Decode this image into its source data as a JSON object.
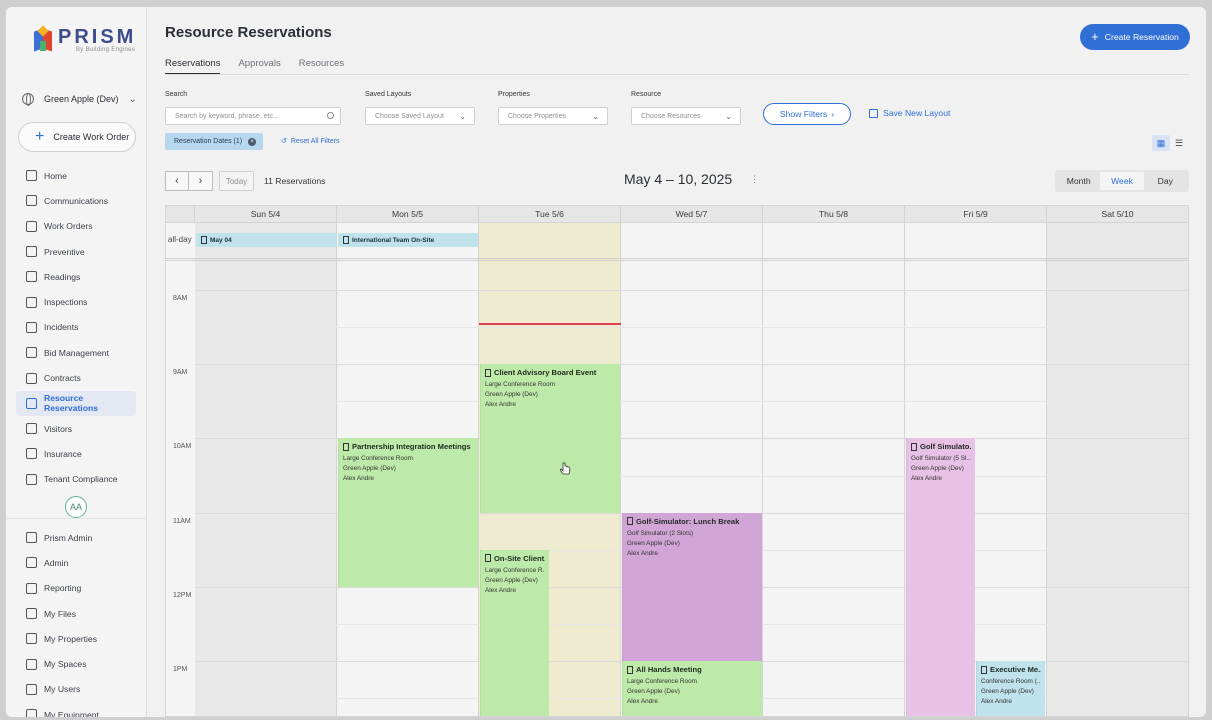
{
  "brand": {
    "name": "PRISM",
    "sub": "By Building Engines"
  },
  "sidebar": {
    "property": "Green Apple (Dev)",
    "create_work_order": "Create Work Order",
    "items": [
      {
        "label": "Home",
        "icon": "home-icon",
        "active": false
      },
      {
        "label": "Communications",
        "icon": "megaphone-icon",
        "active": false
      },
      {
        "label": "Work Orders",
        "icon": "wrench-icon",
        "active": false
      },
      {
        "label": "Preventive",
        "icon": "calendar-check-icon",
        "active": false
      },
      {
        "label": "Readings",
        "icon": "gauge-icon",
        "active": false
      },
      {
        "label": "Inspections",
        "icon": "clipboard-icon",
        "active": false
      },
      {
        "label": "Incidents",
        "icon": "alert-icon",
        "active": false
      },
      {
        "label": "Bid Management",
        "icon": "gavel-icon",
        "active": false
      },
      {
        "label": "Contracts",
        "icon": "contract-icon",
        "active": false
      },
      {
        "label": "Resource Reservations",
        "icon": "calendar-icon",
        "active": true
      },
      {
        "label": "Visitors",
        "icon": "visitor-icon",
        "active": false
      },
      {
        "label": "Insurance",
        "icon": "shield-icon",
        "active": false
      },
      {
        "label": "Tenant Compliance",
        "icon": "check-circle-icon",
        "active": false
      }
    ],
    "avatar": "AA",
    "bottom_items": [
      {
        "label": "Prism Admin",
        "icon": "gear-icon"
      },
      {
        "label": "Admin",
        "icon": "gear-icon"
      },
      {
        "label": "Reporting",
        "icon": "chart-icon"
      },
      {
        "label": "My Files",
        "icon": "file-icon"
      },
      {
        "label": "My Properties",
        "icon": "building-icon"
      },
      {
        "label": "My Spaces",
        "icon": "layers-icon"
      },
      {
        "label": "My Users",
        "icon": "users-icon"
      },
      {
        "label": "My Equipment",
        "icon": "equipment-icon"
      }
    ]
  },
  "header": {
    "title": "Resource Reservations",
    "create_button": "Create Reservation",
    "tabs": [
      "Reservations",
      "Approvals",
      "Resources"
    ],
    "active_tab": "Reservations"
  },
  "filters": {
    "search_label": "Search",
    "search_placeholder": "Search by keyword, phrase, etc...",
    "saved_layouts_label": "Saved Layouts",
    "saved_layouts_value": "Choose Saved Layout",
    "properties_label": "Properties",
    "properties_value": "Choose Properties",
    "resource_label": "Resource",
    "resource_value": "Choose Resources",
    "show_filters": "Show Filters",
    "save_layout": "Save New Layout",
    "chip": "Reservation Dates (1)",
    "reset": "Reset All Filters"
  },
  "toolbar": {
    "today": "Today",
    "count": "11 Reservations",
    "range": "May 4 – 10, 2025",
    "views": [
      "Month",
      "Week",
      "Day"
    ],
    "active_view": "Week"
  },
  "calendar": {
    "days": [
      "Sun 5/4",
      "Mon 5/5",
      "Tue 5/6",
      "Wed 5/7",
      "Thu 5/8",
      "Fri 5/9",
      "Sat 5/10"
    ],
    "allday_label": "all-day",
    "times": [
      "8AM",
      "9AM",
      "10AM",
      "11AM",
      "12PM",
      "1PM"
    ],
    "allday_events": [
      {
        "title": "May 04",
        "day": 0
      },
      {
        "title": "International Team On-Site",
        "day": 1
      }
    ],
    "events": [
      {
        "title": "Client Advisory Board Event",
        "room": "Large Conference Room",
        "property": "Green Apple (Dev)",
        "person": "Alex Andre",
        "day": 2,
        "start": 9.0,
        "end": 11.0,
        "color": "#bdeaa9"
      },
      {
        "title": "Partnership Integration Meetings",
        "room": "Large Conference Room",
        "property": "Green Apple (Dev)",
        "person": "Alex Andre",
        "day": 1,
        "start": 10.0,
        "end": 12.0,
        "color": "#bdeaa9"
      },
      {
        "title": "Golf Simulato...",
        "room": "Golf Simulator (5 Sl...",
        "property": "Green Apple (Dev)",
        "person": "Alex Andre",
        "day": 5,
        "start": 10.0,
        "end": 13.75,
        "color": "#e7c1e6",
        "half": true
      },
      {
        "title": "Golf-Simulator: Lunch Break",
        "room": "Golf Simulator (2 Slots)",
        "property": "Green Apple (Dev)",
        "person": "Alex Andre",
        "day": 3,
        "start": 11.0,
        "end": 13.0,
        "color": "#d1a6d7"
      },
      {
        "title": "On-Site Client...",
        "room": "Large Conference R...",
        "property": "Green Apple (Dev)",
        "person": "Alex Andre",
        "day": 2,
        "start": 11.5,
        "end": 13.75,
        "color": "#bdeaa9",
        "half": true
      },
      {
        "title": "All Hands Meeting",
        "room": "Large Conference Room",
        "property": "Green Apple (Dev)",
        "person": "Alex Andre",
        "day": 3,
        "start": 13.0,
        "end": 13.75,
        "color": "#bdeaa9"
      },
      {
        "title": "Executive Me...",
        "room": "Conference Room (...",
        "property": "Green Apple (Dev)",
        "person": "Alex Andre",
        "day": 5,
        "start": 13.0,
        "end": 13.75,
        "color": "#bfe2ec",
        "half": true,
        "right": true
      }
    ]
  },
  "colors": {
    "accent": "#2f6fd6",
    "today_column": "#eeebd0",
    "weekend": "#e8e8e8",
    "now_line": "#e0414e"
  }
}
